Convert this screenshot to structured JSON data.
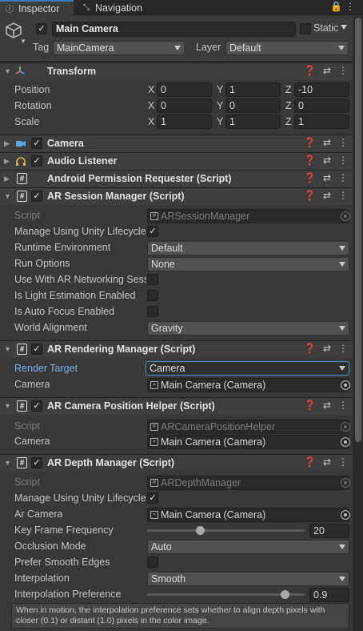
{
  "tabs": [
    {
      "label": "Inspector",
      "icon": "info-icon",
      "active": true
    },
    {
      "label": "Navigation",
      "icon": "navigation-icon",
      "active": false
    }
  ],
  "gameobject": {
    "name": "Main Camera",
    "active": true,
    "static_label": "Static",
    "tag_label": "Tag",
    "tag_value": "MainCamera",
    "layer_label": "Layer",
    "layer_value": "Default"
  },
  "transform": {
    "title": "Transform",
    "rows": [
      {
        "label": "Position",
        "x": "0",
        "y": "1",
        "z": "-10"
      },
      {
        "label": "Rotation",
        "x": "0",
        "y": "0",
        "z": "0"
      },
      {
        "label": "Scale",
        "x": "1",
        "y": "1",
        "z": "1"
      }
    ],
    "axis": {
      "x": "X",
      "y": "Y",
      "z": "Z"
    }
  },
  "components": {
    "camera": "Camera",
    "audio_listener": "Audio Listener",
    "android_perm": "Android Permission Requester (Script)",
    "session": "AR Session Manager (Script)",
    "rendering": "AR Rendering Manager (Script)",
    "cam_pos": "AR Camera Position Helper (Script)",
    "depth": "AR Depth Manager (Script)"
  },
  "session": {
    "script_label": "Script",
    "script_value": "ARSessionManager",
    "manage_label": "Manage Using Unity Lifecycle",
    "manage_checked": true,
    "runtime_label": "Runtime Environment",
    "runtime_value": "Default",
    "run_options_label": "Run Options",
    "run_options_value": "None",
    "networking_label": "Use With AR Networking Session",
    "networking_checked": false,
    "light_label": "Is Light Estimation Enabled",
    "light_checked": false,
    "autofocus_label": "Is Auto Focus Enabled",
    "autofocus_checked": false,
    "world_label": "World Alignment",
    "world_value": "Gravity"
  },
  "rendering": {
    "target_label": "Render Target",
    "target_value": "Camera",
    "camera_label": "Camera",
    "camera_value": "Main Camera (Camera)"
  },
  "cam_pos": {
    "script_label": "Script",
    "script_value": "ARCameraPositionHelper",
    "camera_label": "Camera",
    "camera_value": "Main Camera (Camera)"
  },
  "depth": {
    "script_label": "Script",
    "script_value": "ARDepthManager",
    "manage_label": "Manage Using Unity Lifecycle",
    "manage_checked": true,
    "arcam_label": "Ar Camera",
    "arcam_value": "Main Camera (Camera)",
    "kff_label": "Key Frame Frequency",
    "kff_value": "20",
    "kff_fraction": 0.33,
    "occlusion_label": "Occlusion Mode",
    "occlusion_value": "Auto",
    "smooth_label": "Prefer Smooth Edges",
    "smooth_checked": false,
    "interp_label": "Interpolation",
    "interp_value": "Smooth",
    "interp_pref_label": "Interpolation Preference",
    "interp_pref_value": "0.9",
    "interp_pref_fraction": 0.9,
    "help": "When in motion, the interpolation preference sets whether to align depth pixels with closer (0.1) or distant (1.0) pixels in the color image."
  },
  "check_glyph": "✓"
}
